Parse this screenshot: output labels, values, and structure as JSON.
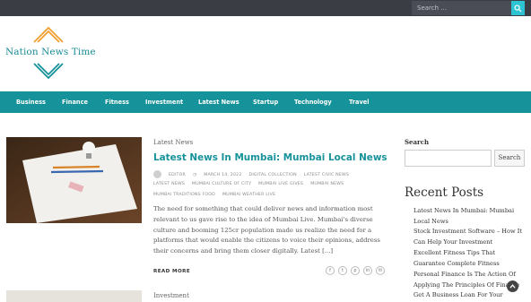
{
  "topbar": {
    "search_placeholder": "Search ..."
  },
  "site": {
    "title": "Nation News Time"
  },
  "nav": [
    "Business",
    "Finance",
    "Fitness",
    "Investment",
    "Latest News",
    "Startup",
    "Technology",
    "Travel"
  ],
  "article": {
    "category": "Latest News",
    "title": "Latest News In Mumbai: Mumbai Local News",
    "author": "EDITOR",
    "date": "MARCH 14, 2022",
    "tags_line1": [
      "DIGITAL COLLECTION",
      "LATEST CIVIC NEWS"
    ],
    "tags_line2": [
      "LATEST NEWS",
      "MUMBAI CULTURE OF CITY",
      "MUMBAI LIVE GIVES",
      "MUMBAI NEWS"
    ],
    "tags_line3": [
      "MUMBAI TRADITIONS FOOD",
      "MUMBAI WEATHER LIVE"
    ],
    "excerpt": "The need for something that could deliver news and information most relevant to us gave rise to the idea of Mumbai Live. Mumbai's diverse culture and booming 125cr population made us realize the need for a platforms that would enable the citizens to voice their opinions, address their concerns and bring them closer digitally. Latest [...]",
    "read_more": "READ MORE"
  },
  "article2": {
    "category": "Investment"
  },
  "sidebar": {
    "search_label": "Search",
    "search_button": "Search",
    "recent_title": "Recent Posts",
    "recent_posts": [
      "Latest News In Mumbai: Mumbai Local News",
      "Stock Investment Software – How It Can Help Your Investment",
      "Excellent Fitness Tips That Guarantee Complete Fitness",
      "Personal Finance Is The Action Of Applying The Principles Of Finance",
      "Get A Business Loan For Your"
    ]
  },
  "colors": {
    "accent": "#16929a",
    "topbar": "#3a3d44",
    "search_button": "#2cc4d3",
    "logo_orange": "#f0a030",
    "logo_teal": "#16929a"
  }
}
